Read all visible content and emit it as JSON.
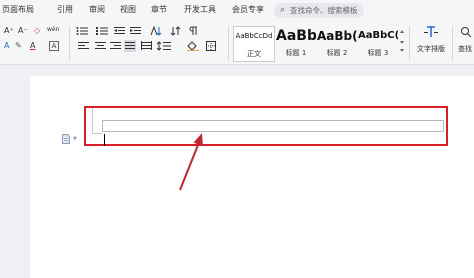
{
  "menu": {
    "items": [
      "页面布局",
      "引用",
      "审阅",
      "视图",
      "章节",
      "开发工具",
      "会员专享"
    ],
    "search_placeholder": "查找命令、搜索模板"
  },
  "toolbar": {
    "row1": {
      "font_grow_label": "A⁺",
      "font_shrink_label": "A⁻",
      "clear_format_label": "◇",
      "pinyin_label": "wén",
      "text_effect_label": "A",
      "highlight_label": "✎",
      "font_color_label": "A",
      "char_border_label": "A"
    },
    "styles": [
      {
        "sample": "AaBbCcDd",
        "name": "正文",
        "size": "7px"
      },
      {
        "sample": "AaBb",
        "name": "标题 1",
        "size": "15px"
      },
      {
        "sample": "AaBb(",
        "name": "标题 2",
        "size": "13px"
      },
      {
        "sample": "AaBbC(",
        "name": "标题 3",
        "size": "11px"
      }
    ],
    "text_layout_label": "文字排版",
    "overflow_label": "查找"
  },
  "colors": {
    "highlight_box": "#d61f26",
    "arrow": "#c0282d",
    "paragraph_icon": "#8a9bb8"
  }
}
